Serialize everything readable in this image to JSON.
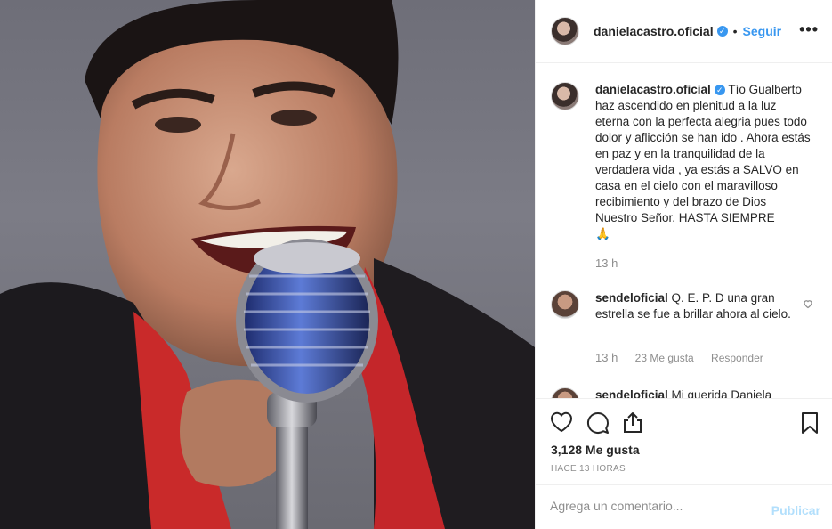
{
  "header": {
    "username": "danielacastro.oficial",
    "separator": "•",
    "follow_label": "Seguir",
    "more_label": "•••"
  },
  "caption": {
    "username": "danielacastro.oficial",
    "text": "Tío Gualberto haz ascendido en plenitud a la luz eterna con la perfecta alegria pues todo dolor y aflicción se han ido . Ahora estás en paz y en la tranquilidad de la verdadera vida , ya estás a SALVO en casa en el cielo con el maravilloso recibimiento y del brazo de Dios Nuestro Señor. HASTA SIEMPRE",
    "emoji": "🙏",
    "time": "13 h"
  },
  "comments": [
    {
      "username": "sendeloficial",
      "text": "Q. E. P. D una gran estrella se fue a brillar ahora al cielo.",
      "time": "13 h",
      "likes": "23 Me gusta",
      "reply_label": "Responder"
    },
    {
      "username": "sendeloficial",
      "text": "Mi querida Daniela"
    }
  ],
  "actions": {
    "likes_count": "3,128 Me gusta",
    "time_ago": "HACE 13 HORAS"
  },
  "add_comment": {
    "placeholder": "Agrega un comentario...",
    "publish_label": "Publicar"
  },
  "colors": {
    "accent": "#3897f0",
    "publish_disabled": "#b2dffc",
    "muted": "#8e8e8e"
  }
}
